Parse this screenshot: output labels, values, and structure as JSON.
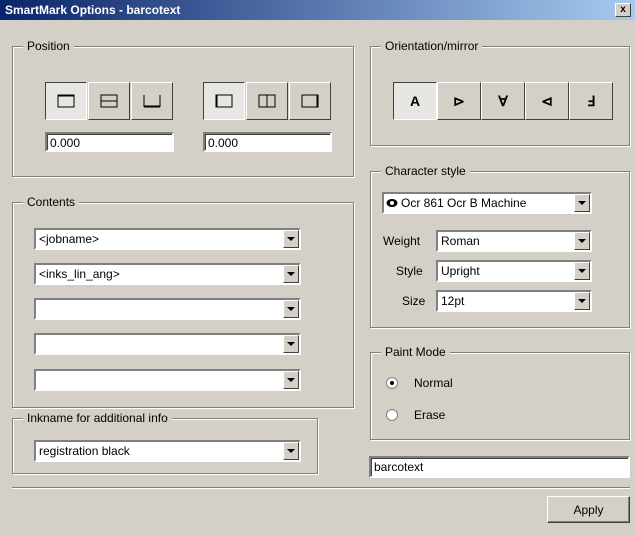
{
  "window": {
    "title": "SmartMark Options - barcotext",
    "close": "x"
  },
  "position": {
    "legend": "Position",
    "vertical_value": "0.000",
    "horizontal_value": "0.000"
  },
  "orientation": {
    "legend": "Orientation/mirror",
    "buttons": [
      "A",
      "⊳",
      "∀",
      "⊲",
      "Ⅎ"
    ]
  },
  "character_style": {
    "legend": "Character style",
    "font": "Ocr 861 Ocr B Machine",
    "weight_label": "Weight",
    "weight": "Roman",
    "style_label": "Style",
    "style": "Upright",
    "size_label": "Size",
    "size": "12pt"
  },
  "contents": {
    "legend": "Contents",
    "items": [
      "<jobname>",
      "<inks_lin_ang>",
      "",
      "",
      ""
    ]
  },
  "paint_mode": {
    "legend": "Paint Mode",
    "options": [
      "Normal",
      "Erase"
    ],
    "selected": "Normal"
  },
  "inkname": {
    "legend": "Inkname for additional info",
    "value": "registration black"
  },
  "name_field": "barcotext",
  "apply_label": "Apply"
}
